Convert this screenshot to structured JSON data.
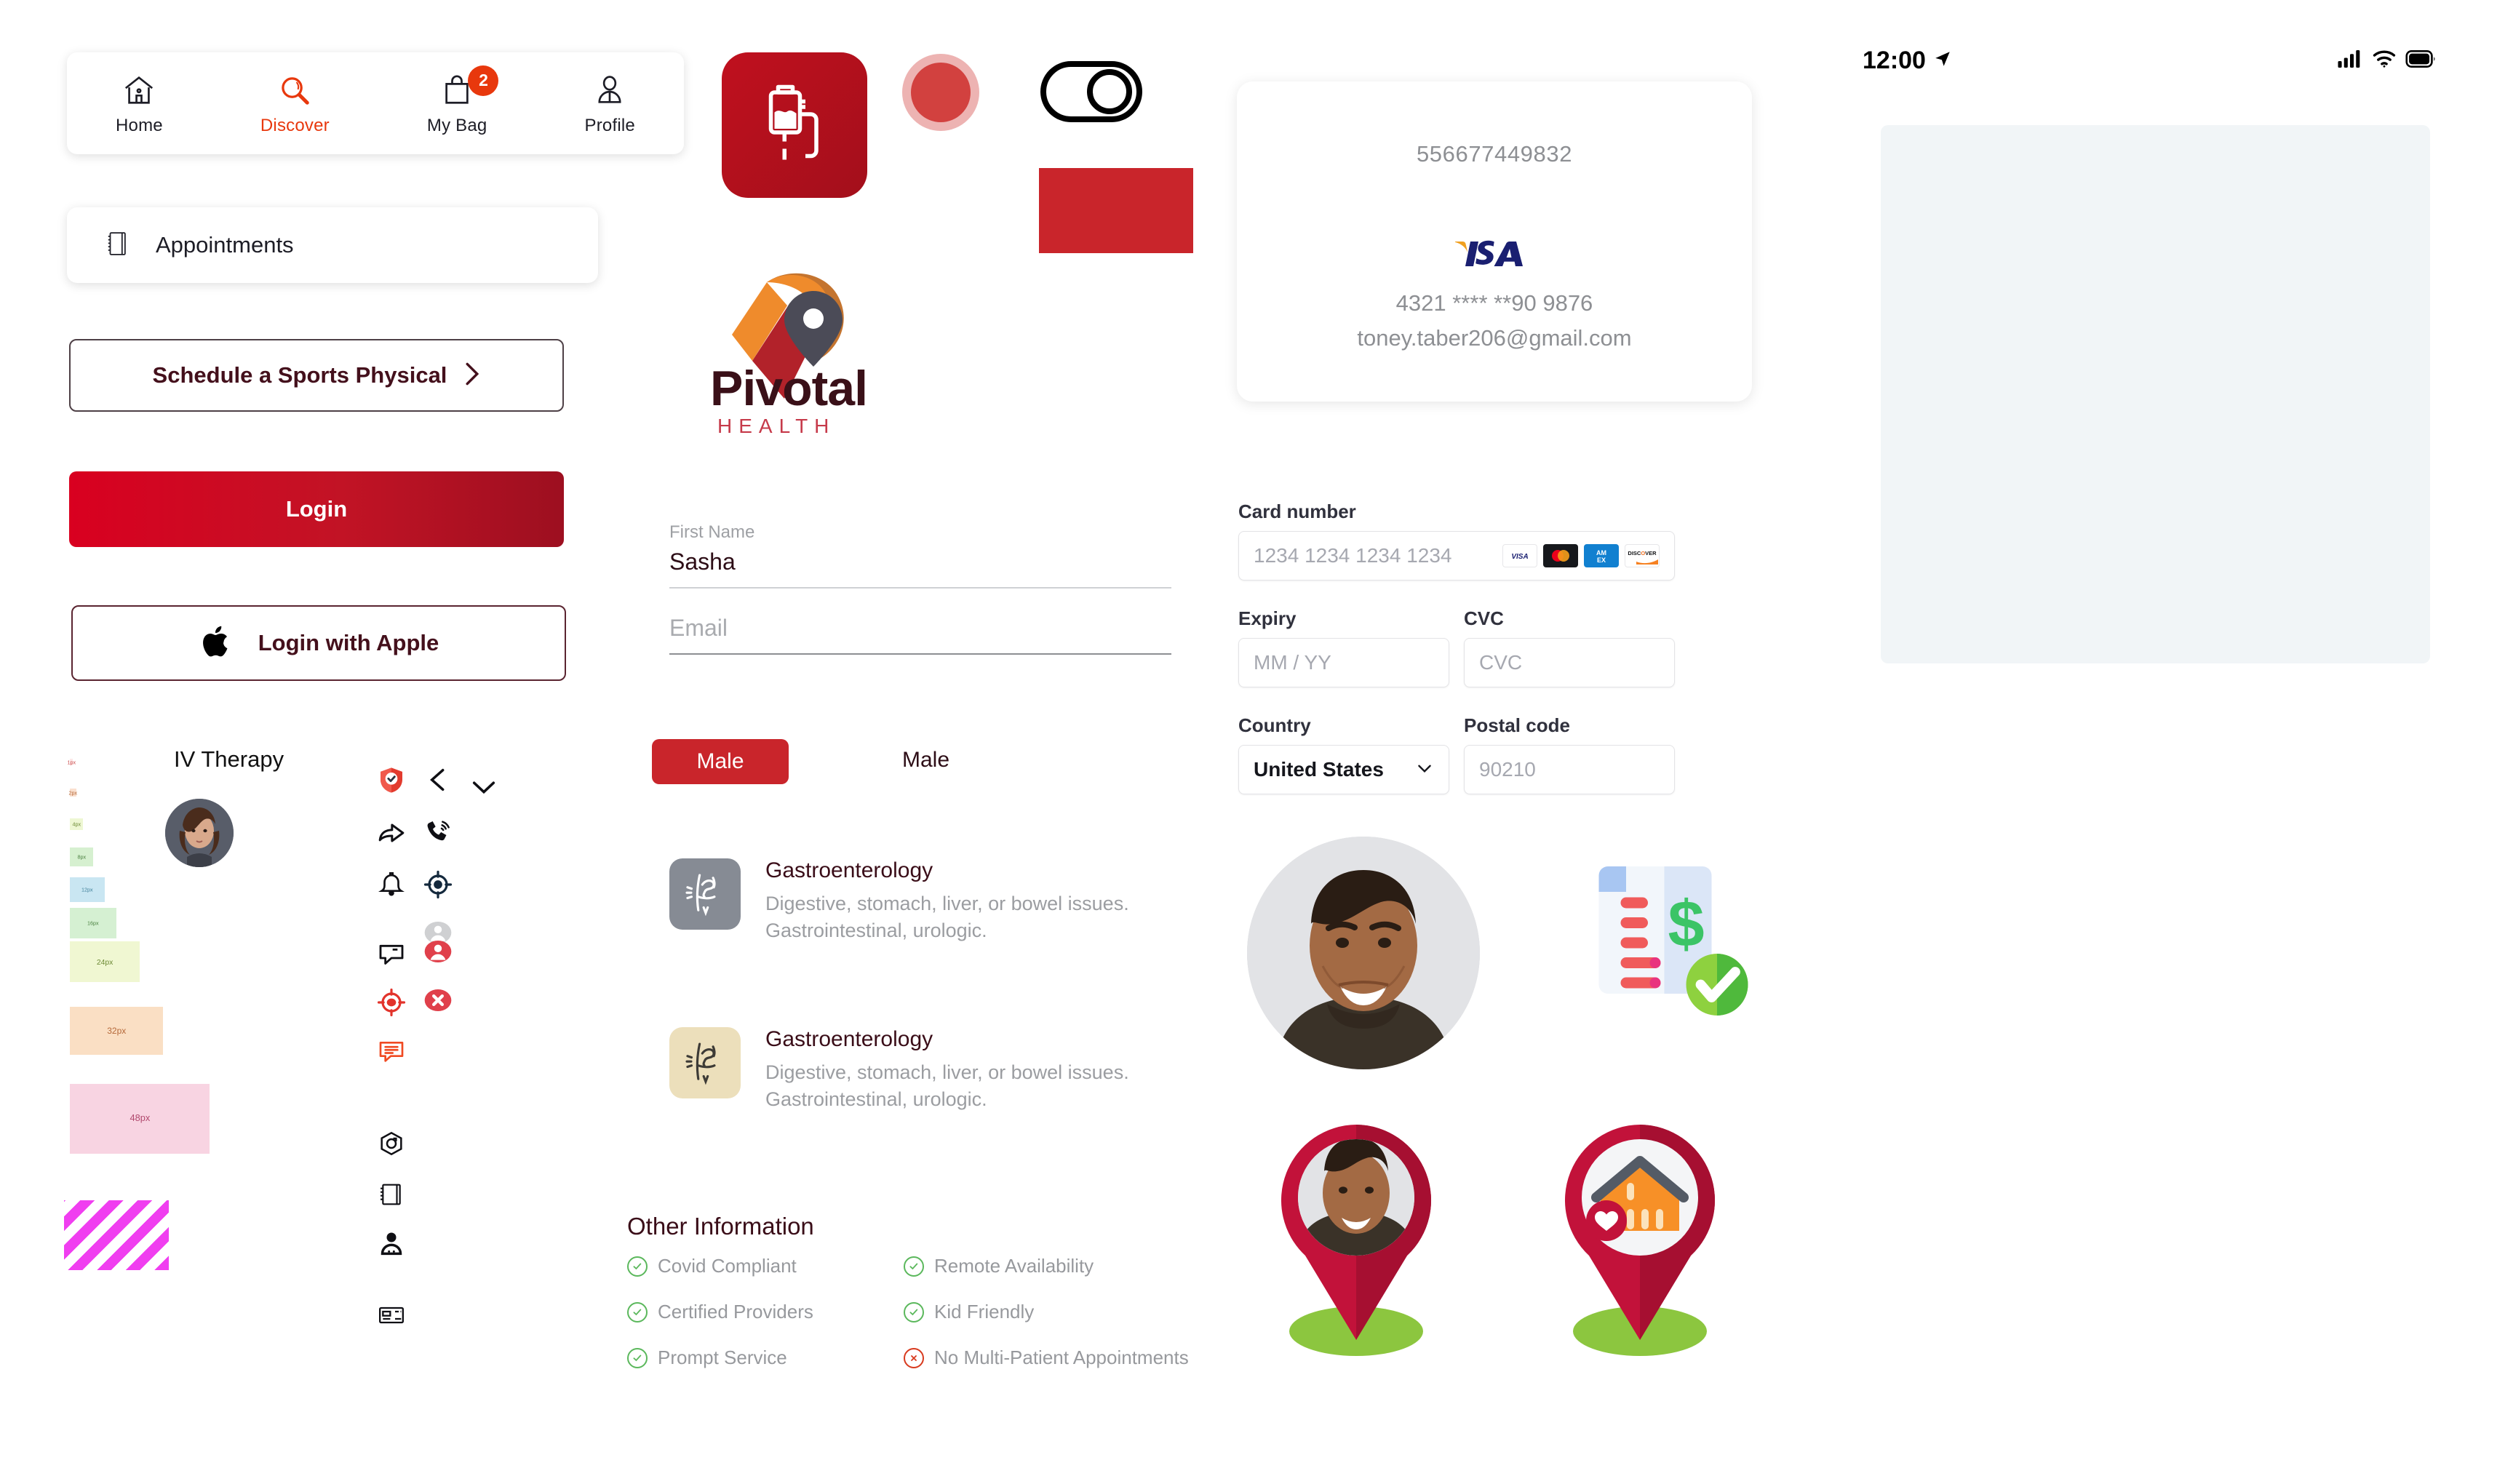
{
  "tabbar": {
    "tabs": [
      {
        "label": "Home",
        "icon": "home-icon",
        "active": false
      },
      {
        "label": "Discover",
        "icon": "search-icon",
        "active": true
      },
      {
        "label": "My Bag",
        "icon": "shopping-bag-icon",
        "active": false,
        "badge": "2"
      },
      {
        "label": "Profile",
        "icon": "user-icon",
        "active": false
      }
    ],
    "active_color": "#e8380d"
  },
  "list_row": {
    "label": "Appointments",
    "icon": "notebook-icon"
  },
  "buttons": {
    "schedule_label": "Schedule a Sports Physical",
    "schedule_chevron": "chevron-right-icon",
    "login_label": "Login",
    "apple_label": "Login with Apple",
    "apple_icon": "apple-icon",
    "primary_gradient_from": "#d90020",
    "primary_gradient_to": "#9d0f20"
  },
  "avatar_block": {
    "label": "IV Therapy"
  },
  "spacing_scale": [
    {
      "size": "1px",
      "px": 1,
      "color": "#fde8e8",
      "text_color": "#c94a4a"
    },
    {
      "size": "2px",
      "px": 2,
      "color": "#fae0cf",
      "text_color": "#b5693a"
    },
    {
      "size": "4px",
      "px": 4,
      "color": "#eef7d3",
      "text_color": "#6d8a36"
    },
    {
      "size": "8px",
      "px": 8,
      "color": "#d6f0d0",
      "text_color": "#4b8040"
    },
    {
      "size": "12px",
      "px": 12,
      "color": "#c9e6f2",
      "text_color": "#3f7f99"
    },
    {
      "size": "16px",
      "px": 16,
      "color": "#d5f0d2",
      "text_color": "#4b8040"
    },
    {
      "size": "24px",
      "px": 24,
      "color": "#f0f7d2",
      "text_color": "#6d8a36"
    },
    {
      "size": "32px",
      "px": 32,
      "color": "#fadfc4",
      "text_color": "#b5693a"
    },
    {
      "size": "48px",
      "px": 48,
      "color": "#f8d4e2",
      "text_color": "#b1496e"
    }
  ],
  "hatch_pattern": {
    "name": "diagonal-hatch-swatch",
    "color": "#f03ef0"
  },
  "icon_library": [
    "shield-check-icon",
    "chevron-left-icon",
    "chevron-down-icon",
    "share-arrow-icon",
    "phone-ring-icon",
    "bell-icon",
    "target-dark-icon",
    "avatar-placeholder-grey-icon",
    "chat-bubble-icon",
    "avatar-placeholder-red-icon",
    "target-red-icon",
    "error-circle-icon",
    "chat-lines-red-icon",
    "hex-camera-icon",
    "notebook-icon",
    "patient-icon",
    "id-card-icon"
  ],
  "brand": {
    "app_icon": "iv-drip-icon",
    "dot": "red-dot-swatch",
    "toggle": "toggle-outline-icon",
    "square": "red-square-swatch",
    "logo_icon": "pivotal-pin-logo",
    "logo_word": "Pivotal",
    "logo_sub": "HEALTH",
    "word_color": "#3a1018",
    "sub_color": "#c63a4a"
  },
  "profile_form": {
    "first_name": {
      "label": "First Name",
      "value": "Sasha"
    },
    "email": {
      "label": "",
      "placeholder": "Email"
    },
    "gender_selected": "Male",
    "gender_plain": "Male"
  },
  "specialties": [
    {
      "title": "Gastroenterology",
      "description": "Digestive, stomach, liver, or bowel issues. Gastrointestinal, urologic.",
      "thumb_color": "#868b94",
      "thumb_stroke": "#ffffff",
      "icon": "abdomen-pain-icon"
    },
    {
      "title": "Gastroenterology",
      "description": "Digestive, stomach, liver, or bowel issues. Gastrointestinal, urologic.",
      "thumb_color": "#ecdfbb",
      "thumb_stroke": "#3d3b36",
      "icon": "abdomen-pain-icon"
    }
  ],
  "other_information": {
    "title": "Other Information",
    "items": [
      {
        "label": "Covid Compliant",
        "ok": true
      },
      {
        "label": "Remote Availability",
        "ok": true
      },
      {
        "label": "Certified Providers",
        "ok": true
      },
      {
        "label": "Kid Friendly",
        "ok": true
      },
      {
        "label": "Prompt Service",
        "ok": true
      },
      {
        "label": "No Multi-Patient Appointments",
        "ok": false
      }
    ],
    "ok_color": "#5bb85c",
    "bad_color": "#d83a1e"
  },
  "saved_card": {
    "account_number": "556677449832",
    "brand": "VISA",
    "masked_number": "4321 **** **90 9876",
    "email": "toney.taber206@gmail.com"
  },
  "payment_form": {
    "card_number": {
      "label": "Card number",
      "placeholder": "1234 1234 1234 1234"
    },
    "accepted_brands": [
      "VISA",
      "mastercard",
      "AMEX",
      "DISCOVER"
    ],
    "expiry": {
      "label": "Expiry",
      "placeholder": "MM / YY"
    },
    "cvc": {
      "label": "CVC",
      "placeholder": "CVC"
    },
    "country": {
      "label": "Country",
      "value": "United States",
      "chevron": "chevron-down-icon"
    },
    "postal_code": {
      "label": "Postal code",
      "placeholder": "90210"
    }
  },
  "media": {
    "doctor_avatar": "doctor-avatar-photo",
    "invoice_icon": "invoice-dollar-check-icon",
    "pin_avatar": "map-pin-avatar",
    "pin_home": "map-pin-home-heart"
  },
  "statusbar": {
    "time": "12:00",
    "location_icon": "location-arrow-icon",
    "cellular_icon": "cellular-bars-icon",
    "wifi_icon": "wifi-icon",
    "battery_icon": "battery-full-icon"
  },
  "screen_placeholder": {
    "name": "blank-screen-placeholder",
    "color": "#f1f5f7"
  }
}
